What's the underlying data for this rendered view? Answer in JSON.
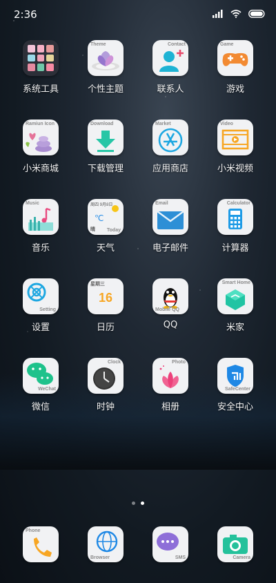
{
  "status": {
    "time": "2:36"
  },
  "home": {
    "rows": [
      [
        {
          "name": "系统工具",
          "tag": ""
        },
        {
          "name": "个性主题",
          "tag": "Theme"
        },
        {
          "name": "联系人",
          "tag": "Contact"
        },
        {
          "name": "游戏",
          "tag": "Game"
        }
      ],
      [
        {
          "name": "小米商城",
          "tag": "Ramiun Icon"
        },
        {
          "name": "下载管理",
          "tag": "Download"
        },
        {
          "name": "应用商店",
          "tag": "Market"
        },
        {
          "name": "小米视频",
          "tag": "Video"
        }
      ],
      [
        {
          "name": "音乐",
          "tag": "Music"
        },
        {
          "name": "天气",
          "tag": "Today",
          "subtag": "周四 9月8日",
          "weather": "晴"
        },
        {
          "name": "电子邮件",
          "tag": "Email"
        },
        {
          "name": "计算器",
          "tag": "Calculator"
        }
      ],
      [
        {
          "name": "设置",
          "tag": "Setting"
        },
        {
          "name": "日历",
          "tag": "",
          "date_head": "星期三",
          "date_num": "16"
        },
        {
          "name": "QQ",
          "tag": "Mobile QQ"
        },
        {
          "name": "米家",
          "tag": "Smart Home"
        }
      ],
      [
        {
          "name": "微信",
          "tag": "WeChat"
        },
        {
          "name": "时钟",
          "tag": "Clock"
        },
        {
          "name": "相册",
          "tag": "Photo"
        },
        {
          "name": "安全中心",
          "tag": "SafeCenter"
        }
      ]
    ]
  },
  "dock": [
    {
      "tag": "Phone"
    },
    {
      "tag": "Browser"
    },
    {
      "tag": "SMS"
    },
    {
      "tag": "Camera"
    }
  ],
  "pager": {
    "pages": 2,
    "current": 2
  }
}
